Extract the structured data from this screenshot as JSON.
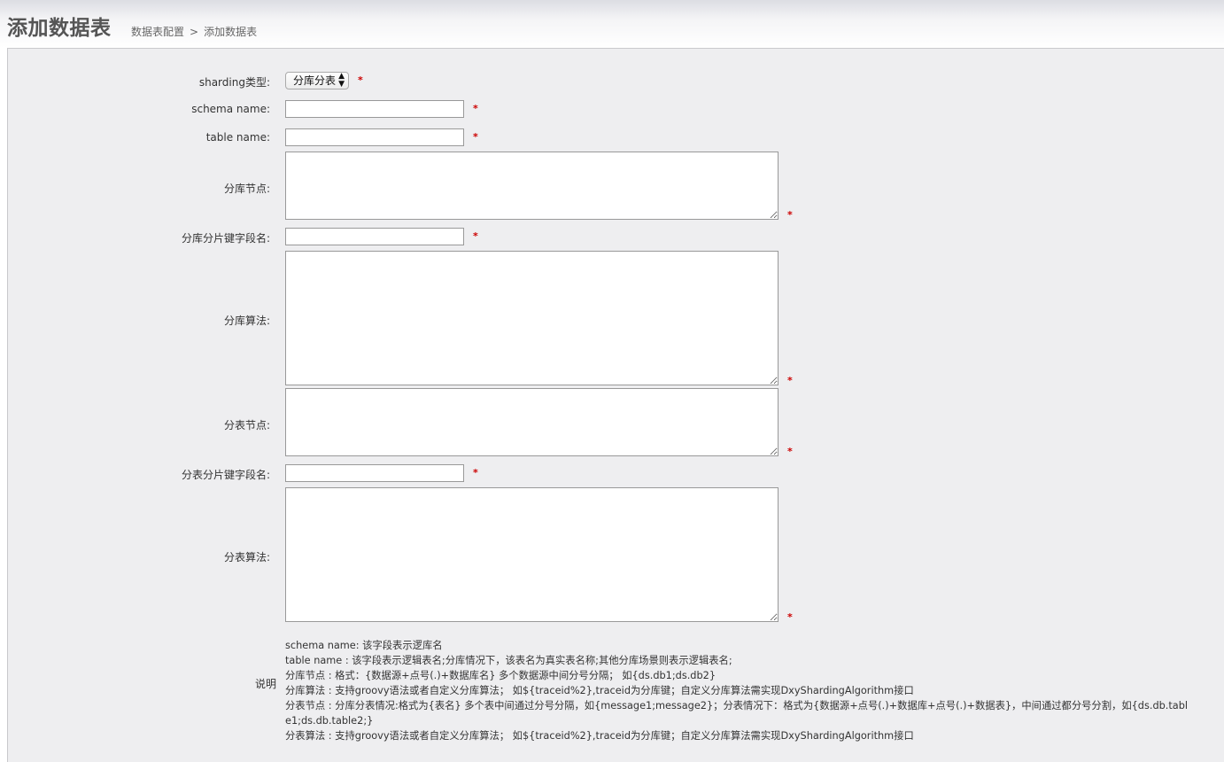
{
  "header": {
    "title": "添加数据表",
    "breadcrumb": [
      "数据表配置",
      "添加数据表"
    ],
    "breadcrumb_separator": ">"
  },
  "form": {
    "required_mark": "*",
    "sharding_type": {
      "label": "sharding类型:",
      "selected": "分库分表"
    },
    "schema_name": {
      "label": "schema name:",
      "value": ""
    },
    "table_name": {
      "label": "table name:",
      "value": ""
    },
    "db_nodes": {
      "label": "分库节点:",
      "value": ""
    },
    "db_shard_key": {
      "label": "分库分片键字段名:",
      "value": ""
    },
    "db_algorithm": {
      "label": "分库算法:",
      "value": ""
    },
    "table_nodes": {
      "label": "分表节点:",
      "value": ""
    },
    "table_shard_key": {
      "label": "分表分片键字段名:",
      "value": ""
    },
    "table_algorithm": {
      "label": "分表算法:",
      "value": ""
    }
  },
  "notes": {
    "label": "说明",
    "lines": [
      "schema name: 该字段表示逻库名",
      "table name : 该字段表示逻辑表名;分库情况下，该表名为真实表名称;其他分库场景则表示逻辑表名;",
      "分库节点 : 格式：{数据源+点号(.)+数据库名} 多个数据源中间分号分隔； 如{ds.db1;ds.db2}",
      "分库算法 : 支持groovy语法或者自定义分库算法； 如${traceid%2},traceid为分库键；自定义分库算法需实现DxyShardingAlgorithm接口",
      "分表节点 : 分库分表情况:格式为{表名} 多个表中间通过分号分隔，如{message1;message2}；分表情况下：格式为{数据源+点号(.)+数据库+点号(.)+数据表}，中间通过都分号分割，如{ds.db.table1;ds.db.table2;}",
      "分表算法 : 支持groovy语法或者自定义分库算法； 如${traceid%2},traceid为分库键；自定义分库算法需实现DxyShardingAlgorithm接口"
    ]
  }
}
